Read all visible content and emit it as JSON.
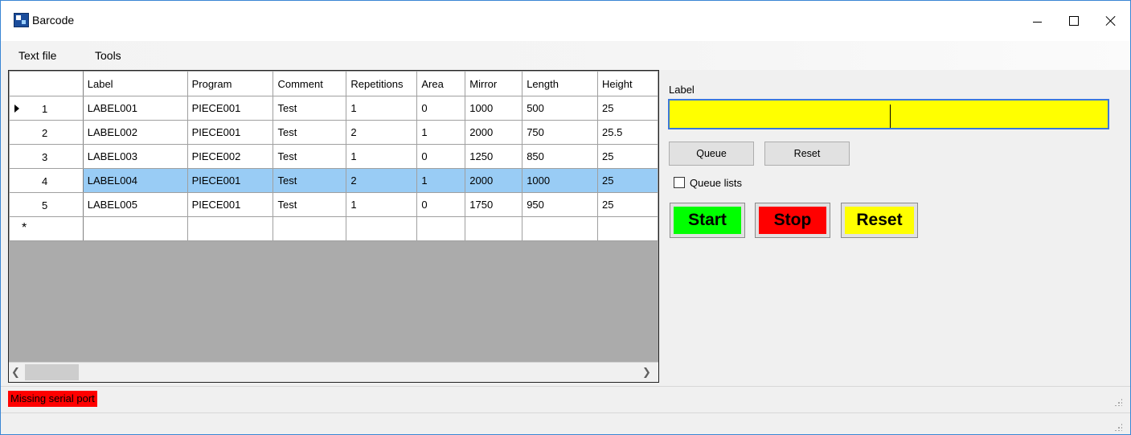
{
  "window": {
    "title": "Barcode",
    "icon": "app-icon"
  },
  "menu": {
    "items": [
      "Text file",
      "Tools"
    ]
  },
  "grid": {
    "columns": [
      "Label",
      "Program",
      "Comment",
      "Repetitions",
      "Area",
      "Mirror",
      "Length",
      "Height"
    ],
    "rows": [
      {
        "num": "1",
        "current": true,
        "selected": false,
        "cells": [
          "LABEL001",
          "PIECE001",
          "Test",
          "1",
          "0",
          "1000",
          "500",
          "25"
        ]
      },
      {
        "num": "2",
        "current": false,
        "selected": false,
        "cells": [
          "LABEL002",
          "PIECE001",
          "Test",
          "2",
          "1",
          "2000",
          "750",
          "25.5"
        ]
      },
      {
        "num": "3",
        "current": false,
        "selected": false,
        "cells": [
          "LABEL003",
          "PIECE002",
          "Test",
          "1",
          "0",
          "1250",
          "850",
          "25"
        ]
      },
      {
        "num": "4",
        "current": false,
        "selected": true,
        "cells": [
          "LABEL004",
          "PIECE001",
          "Test",
          "2",
          "1",
          "2000",
          "1000",
          "25"
        ]
      },
      {
        "num": "5",
        "current": false,
        "selected": false,
        "cells": [
          "LABEL005",
          "PIECE001",
          "Test",
          "1",
          "0",
          "1750",
          "950",
          "25"
        ]
      }
    ],
    "new_row_marker": "*",
    "scroll_left_icon": "chevron-left-icon",
    "scroll_right_icon": "chevron-right-icon"
  },
  "panel": {
    "label_caption": "Label",
    "label_value": "",
    "queue_label": "Queue",
    "reset_label": "Reset",
    "queue_lists_label": "Queue lists",
    "queue_lists_checked": false,
    "start_label": "Start",
    "stop_label": "Stop",
    "reset_big_label": "Reset"
  },
  "colors": {
    "start": "#00ff00",
    "stop": "#ff0000",
    "reset": "#ffff00",
    "selection": "#99ccf5",
    "status_error": "#ff0000",
    "input_bg": "#ffff00"
  },
  "status": {
    "message": "Missing serial port"
  }
}
